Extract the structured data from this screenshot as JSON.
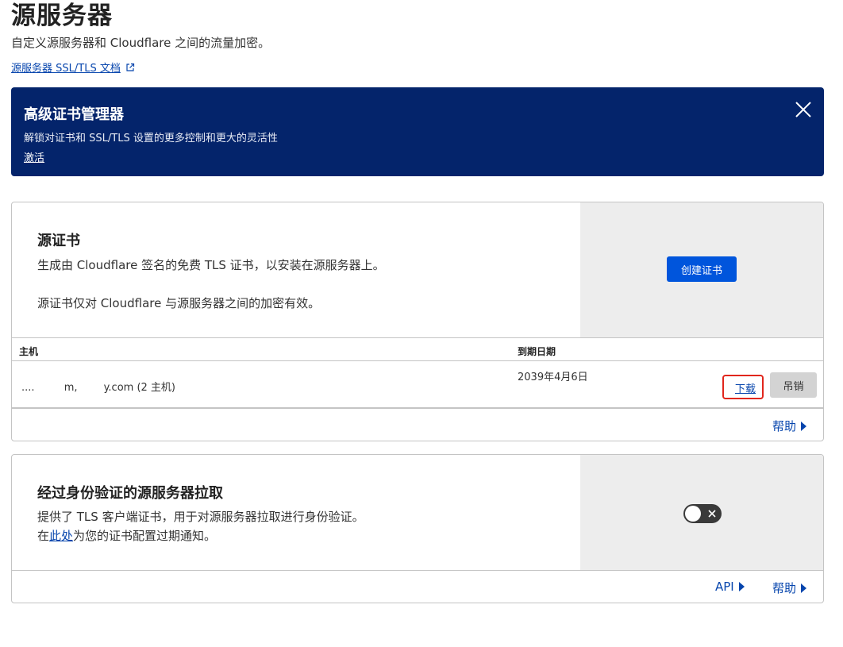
{
  "page": {
    "title": "源服务器",
    "subtitle": "自定义源服务器和 Cloudflare 之间的流量加密。",
    "doc_link": "源服务器 SSL/TLS 文档"
  },
  "banner": {
    "title": "高级证书管理器",
    "description": "解锁对证书和 SSL/TLS 设置的更多控制和更大的灵活性",
    "activate": "激活",
    "background": "#04246b"
  },
  "origin_certs": {
    "title": "源证书",
    "line1": "生成由 Cloudflare 签名的免费 TLS 证书，以安装在源服务器上。",
    "line2": "源证书仅对 Cloudflare 与源服务器之间的加密有效。",
    "create_button": "创建证书",
    "table": {
      "headers": {
        "host": "主机",
        "expiry": "到期日期"
      },
      "rows": [
        {
          "host": "....         m,        y.com (2 主机)",
          "expiry": "2039年4月6日",
          "download": "下载",
          "revoke": "吊销"
        }
      ]
    },
    "help": "帮助"
  },
  "aop": {
    "title": "经过身份验证的源服务器拉取",
    "line1": "提供了 TLS 客户端证书，用于对源服务器拉取进行身份验证。",
    "line2_prefix": "在",
    "line2_link": "此处",
    "line2_suffix": "为您的证书配置过期通知。",
    "toggle_state": "off",
    "api": "API",
    "help": "帮助"
  },
  "colors": {
    "link": "#0645ad",
    "primary_button": "#0055dc",
    "highlight_border": "#e1261c"
  }
}
